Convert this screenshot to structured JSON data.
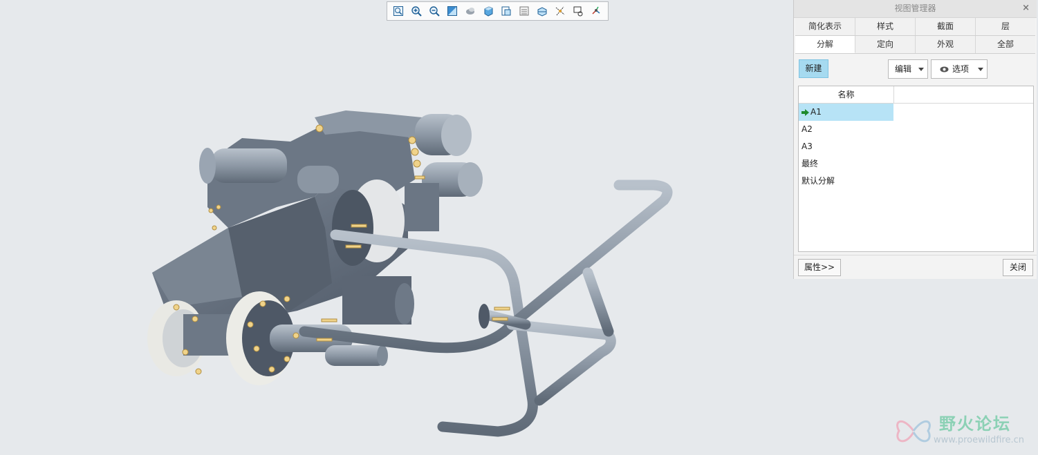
{
  "toolbar": {
    "buttons": [
      {
        "icon": "refit-icon"
      },
      {
        "icon": "zoom-in-icon"
      },
      {
        "icon": "zoom-out-icon"
      },
      {
        "icon": "repaint-icon"
      },
      {
        "icon": "perspective-icon"
      },
      {
        "icon": "display-style-icon"
      },
      {
        "icon": "saved-views-icon"
      },
      {
        "icon": "view-manager-icon"
      },
      {
        "icon": "section-icon"
      },
      {
        "icon": "datum-display-icon"
      },
      {
        "icon": "annotation-display-icon"
      },
      {
        "icon": "spin-center-icon"
      }
    ]
  },
  "panel": {
    "title": "视图管理器",
    "close_glyph": "×",
    "tabs_row1": [
      "简化表示",
      "样式",
      "截面",
      "层"
    ],
    "tabs_row2": [
      "分解",
      "定向",
      "外观",
      "全部"
    ],
    "active_tab": "分解",
    "new_label": "新建",
    "edit_label": "编辑",
    "options_label": "选项",
    "list_header": "名称",
    "items": [
      "A1",
      "A2",
      "A3",
      "最终",
      "默认分解"
    ],
    "selected_item": "A1",
    "properties_label": "属性>>",
    "close_label": "关闭"
  },
  "watermark": {
    "title": "野火论坛",
    "url": "www.proewildfire.cn"
  },
  "colors": {
    "background": "#e6e9ec",
    "accent_selected": "#b7e3f6",
    "button_new": "#a6daf0",
    "model_steel": "#5f6a78",
    "model_tube": "#8f9aa7",
    "fastener": "#f0d38a"
  }
}
